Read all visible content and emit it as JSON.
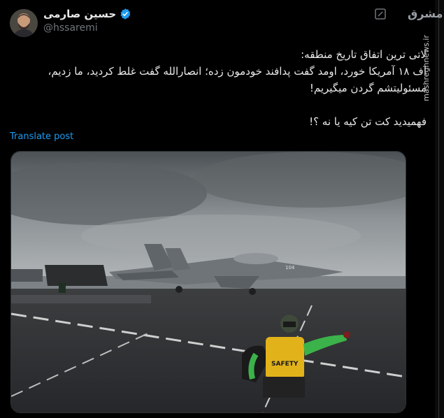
{
  "author": {
    "name": "حسین صارمی",
    "handle": "@hssaremi",
    "verified": true,
    "avatar_icon": "avatar-photo"
  },
  "tweet": {
    "text": "لاتی ترین اتفاق تاریخ منطقه:\nاف ۱۸ آمریکا خورد، اومد گفت پدافند خودمون زده؛ انصارالله گفت غلط کردید، ما زدیم، مسئولیتشم گردن میگیریم!\n\nفهمیدید کت تن کیه یا نه ؟!",
    "translate_label": "Translate post"
  },
  "watermark": {
    "logo_text": "مشرق",
    "site": "mashreghnews.ir"
  },
  "media": {
    "aircraft_number": "104",
    "vest_text": "SAFETY"
  },
  "colors": {
    "background": "#000000",
    "text": "#e7e9ea",
    "secondary": "#71767b",
    "link": "#1d9bf0",
    "verified": "#1d9bf0"
  }
}
